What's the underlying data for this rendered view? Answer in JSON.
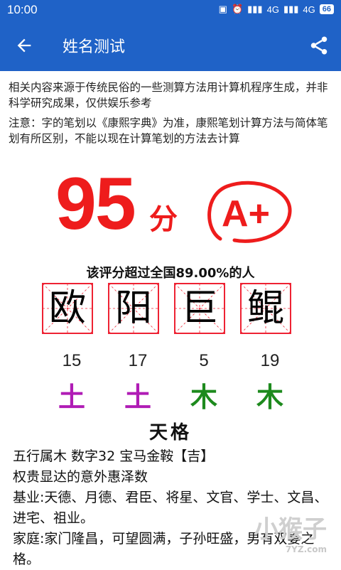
{
  "status": {
    "time": "10:00",
    "network1": "4G",
    "network2": "4G",
    "battery": "66"
  },
  "appbar": {
    "title": "姓名测试"
  },
  "notice": {
    "line1": "相关内容来源于传统民俗的一些测算方法用计算机程序生成，并非科学研究成果，仅供娱乐参考",
    "line2": "注意：字的笔划以《康熙字典》为准，康熙笔划计算方法与简体笔划有所区别，不能以现在计算笔划的方法去计算"
  },
  "score": {
    "value": "95",
    "unit": "分",
    "grade": "A+",
    "exceed_text": "该评分超过全国89.00%的人"
  },
  "name_chars": [
    {
      "char": "欧",
      "strokes": "15",
      "element": "土",
      "color": "#b01cb5"
    },
    {
      "char": "阳",
      "strokes": "17",
      "element": "土",
      "color": "#b01cb5"
    },
    {
      "char": "巨",
      "strokes": "5",
      "element": "木",
      "color": "#1d8a1d"
    },
    {
      "char": "鲲",
      "strokes": "19",
      "element": "木",
      "color": "#1d8a1d"
    }
  ],
  "section": {
    "title": "天格",
    "line1": "五行属木 数字32 宝马金鞍【吉】",
    "line2": "权贵显达的意外惠泽数",
    "line3": "基业:天德、月德、君臣、将星、文官、学士、文昌、进宅、祖业。",
    "line4": "家庭:家门隆昌，可望圆满，子孙旺盛，男有双妻之格。"
  },
  "watermark": {
    "text": "小猴子",
    "sub": "7YZ.com"
  },
  "colors": {
    "primary": "#1f62c7",
    "score_red": "#ee1c1c",
    "earth": "#b01cb5",
    "wood": "#1d8a1d"
  }
}
